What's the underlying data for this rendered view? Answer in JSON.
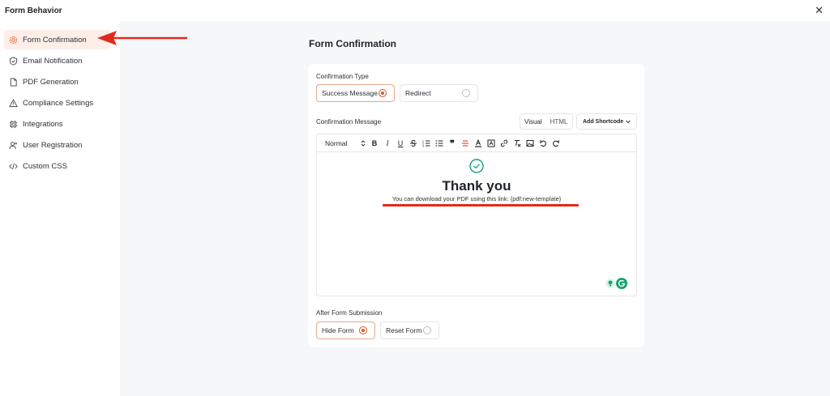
{
  "window": {
    "title": "Form Behavior",
    "close_icon": "close-icon"
  },
  "sidebar": {
    "items": [
      {
        "label": "Form Confirmation",
        "icon": "gear-icon",
        "active": true
      },
      {
        "label": "Email Notification",
        "icon": "shield-icon",
        "active": false
      },
      {
        "label": "PDF Generation",
        "icon": "document-icon",
        "active": false
      },
      {
        "label": "Compliance Settings",
        "icon": "warning-icon",
        "active": false
      },
      {
        "label": "Integrations",
        "icon": "chip-icon",
        "active": false
      },
      {
        "label": "User Registration",
        "icon": "user-add-icon",
        "active": false
      },
      {
        "label": "Custom CSS",
        "icon": "code-icon",
        "active": false
      }
    ]
  },
  "main": {
    "title": "Form Confirmation",
    "confirmation_type": {
      "label": "Confirmation Type",
      "options": [
        {
          "label": "Success Message",
          "selected": true
        },
        {
          "label": "Redirect",
          "selected": false
        }
      ]
    },
    "confirmation_message": {
      "label": "Confirmation Message",
      "tabs": [
        {
          "label": "Visual",
          "active": true
        },
        {
          "label": "HTML",
          "active": false
        }
      ],
      "shortcode_label": "Add Shortcode",
      "toolbar": {
        "format_select": "Normal",
        "buttons": [
          "bold-icon",
          "italic-icon",
          "underline-icon",
          "strikethrough-icon",
          "ordered-list-icon",
          "bullet-list-icon",
          "quote-icon",
          "align-icon",
          "text-color-icon",
          "highlight-icon",
          "link-icon",
          "clear-format-icon",
          "image-icon",
          "undo-icon",
          "redo-icon"
        ]
      },
      "content": {
        "heading": "Thank you",
        "body": "You can download your PDF using this link: {pdf:new-template}"
      }
    },
    "after_submission": {
      "label": "After Form Submission",
      "options": [
        {
          "label": "Hide Form",
          "selected": true
        },
        {
          "label": "Reset Form",
          "selected": false
        }
      ]
    }
  },
  "colors": {
    "accent": "#e0552b",
    "annotation_red": "#e02b1d",
    "active_bg": "#fdeee8",
    "success_green": "#15a36d",
    "main_bg": "#f6f7f9"
  }
}
